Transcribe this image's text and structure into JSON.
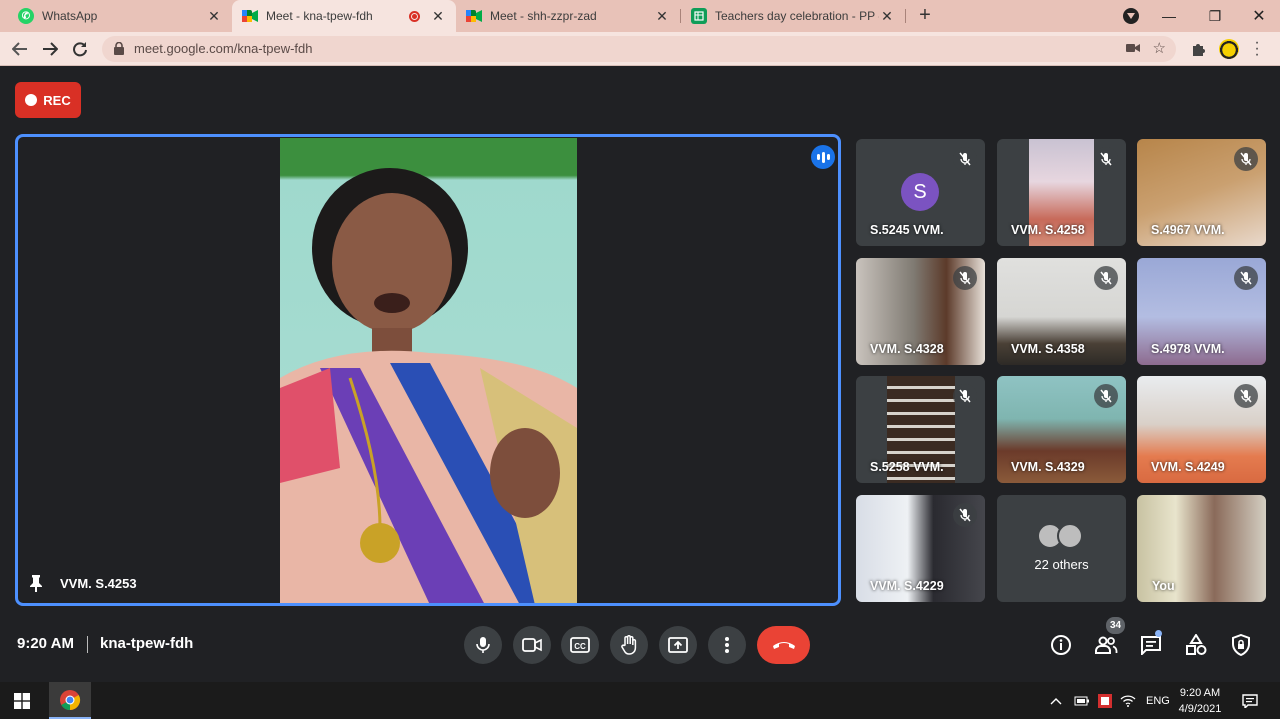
{
  "browser": {
    "tabs": [
      {
        "title": "WhatsApp",
        "close": "✕"
      },
      {
        "title": "Meet - kna-tpew-fdh",
        "close": "✕"
      },
      {
        "title": "Meet - shh-zzpr-zad",
        "close": "✕"
      },
      {
        "title": "Teachers day celebration - PP - G",
        "close": "✕"
      }
    ],
    "new_tab": "+",
    "url": "meet.google.com/kna-tpew-fdh",
    "window_controls": {
      "minimize": "—",
      "maximize": "❐",
      "close": "✕"
    }
  },
  "meet": {
    "rec_label": "REC",
    "stage": {
      "name": "VVM. S.4253"
    },
    "tiles": [
      {
        "name": "S.5245 VVM.",
        "avatar_letter": "S"
      },
      {
        "name": "VVM. S.4258"
      },
      {
        "name": "S.4967 VVM."
      },
      {
        "name": "VVM. S.4328"
      },
      {
        "name": "VVM. S.4358"
      },
      {
        "name": "S.4978 VVM."
      },
      {
        "name": "S.5258 VVM."
      },
      {
        "name": "VVM. S.4329"
      },
      {
        "name": "VVM. S.4249"
      },
      {
        "name": "VVM. S.4229"
      },
      {
        "others_label": "22 others"
      },
      {
        "name": "You"
      }
    ],
    "bottom": {
      "time": "9:20 AM",
      "meeting_code": "kna-tpew-fdh",
      "participants_count": "34"
    }
  },
  "taskbar": {
    "language": "ENG",
    "time": "9:20 AM",
    "date": "4/9/2021"
  },
  "colors": {
    "accent_blue": "#4d90fe",
    "rec_red": "#d93025",
    "leave_red": "#ea4335",
    "meet_bg": "#202124",
    "tab_bar": "#e8c2b8"
  }
}
